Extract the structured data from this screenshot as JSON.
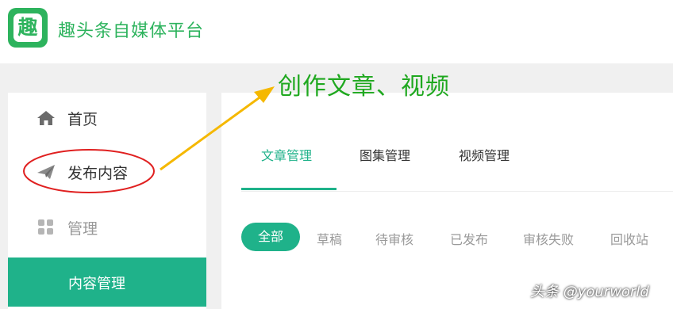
{
  "header": {
    "logo_char": "趣",
    "brand_title": "趣头条自媒体平台",
    "brand_color": "#2db35d"
  },
  "annotation": {
    "title": "创作文章、视频",
    "title_color": "#1fa81f",
    "arrow_color": "#f5b800",
    "circle_color": "#e02020"
  },
  "sidebar": {
    "items": [
      {
        "label": "首页",
        "icon": "home-icon"
      },
      {
        "label": "发布内容",
        "icon": "paper-plane-icon"
      },
      {
        "label": "管理",
        "icon": "grid-icon"
      }
    ],
    "active_item": {
      "label": "内容管理"
    },
    "accent": "#1fb28a"
  },
  "main": {
    "tabs": [
      {
        "label": "文章管理",
        "active": true
      },
      {
        "label": "图集管理",
        "active": false
      },
      {
        "label": "视频管理",
        "active": false
      }
    ],
    "filters": {
      "selected": "全部",
      "others": [
        "草稿",
        "待审核",
        "已发布",
        "审核失败",
        "回收站"
      ]
    }
  },
  "watermark": "头条 @yourworld"
}
